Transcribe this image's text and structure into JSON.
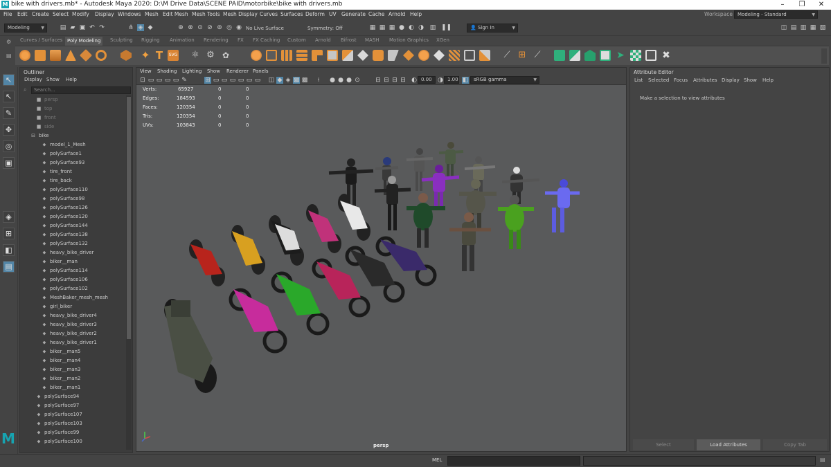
{
  "window": {
    "title": "bike with drivers.mb* - Autodesk Maya 2020: D:\\M Drive Data\\SCENE PAID\\motorbike\\bike with drivers.mb"
  },
  "menubar": {
    "items": [
      "File",
      "Edit",
      "Create",
      "Select",
      "Modify",
      "Display",
      "Windows",
      "Mesh",
      "Edit Mesh",
      "Mesh Tools",
      "Mesh Display",
      "Curves",
      "Surfaces",
      "Deform",
      "UV",
      "Generate",
      "Cache",
      "Arnold",
      "Help"
    ],
    "workspace_label": "Workspace :",
    "workspace_value": "Modeling - Standard"
  },
  "statusline": {
    "mode": "Modeling",
    "live_surface": "No Live Surface",
    "symmetry": "Symmetry: Off",
    "sign_in": "Sign In"
  },
  "shelf": {
    "tabs": [
      "Curves / Surfaces",
      "Poly Modeling",
      "Sculpting",
      "Rigging",
      "Animation",
      "Rendering",
      "FX",
      "FX Caching",
      "Custom",
      "Arnold",
      "Bifrost",
      "MASH",
      "Motion Graphics",
      "XGen"
    ],
    "active_tab": "Poly Modeling"
  },
  "outliner": {
    "title": "Outliner",
    "menu": [
      "Display",
      "Show",
      "Help"
    ],
    "search_placeholder": "Search...",
    "cameras": [
      "persp",
      "top",
      "front",
      "side"
    ],
    "group": "bike",
    "children": [
      "model_1_Mesh",
      "polySurface1",
      "polySurface93",
      "tire_front",
      "tire_back",
      "polySurface110",
      "polySurface98",
      "polySurface126",
      "polySurface120",
      "polySurface144",
      "polySurface138",
      "polySurface132",
      "heavy_bike_driver",
      "biker__man",
      "polySurface114",
      "polySurface106",
      "polySurface102",
      "MeshBaker_mesh_mesh",
      "girl_biker",
      "heavy_bike_driver4",
      "heavy_bike_driver3",
      "heavy_bike_driver2",
      "heavy_bike_driver1",
      "biker__man5",
      "biker__man4",
      "biker__man3",
      "biker__man2",
      "biker__man1"
    ],
    "roots": [
      "polySurface94",
      "polySurface97",
      "polySurface107",
      "polySurface103",
      "polySurface99",
      "polySurface100"
    ]
  },
  "viewport": {
    "menu": [
      "View",
      "Shading",
      "Lighting",
      "Show",
      "Renderer",
      "Panels"
    ],
    "exposure": "0.00",
    "gamma": "1.00",
    "colorspace": "sRGB gamma",
    "hud": [
      {
        "label": "Verts:",
        "a": "65927",
        "b": "0",
        "c": "0"
      },
      {
        "label": "Edges:",
        "a": "184593",
        "b": "0",
        "c": "0"
      },
      {
        "label": "Faces:",
        "a": "120354",
        "b": "0",
        "c": "0"
      },
      {
        "label": "Tris:",
        "a": "120354",
        "b": "0",
        "c": "0"
      },
      {
        "label": "UVs:",
        "a": "103843",
        "b": "0",
        "c": "0"
      }
    ],
    "camera": "persp"
  },
  "attribute_editor": {
    "title": "Attribute Editor",
    "menu": [
      "List",
      "Selected",
      "Focus",
      "Attributes",
      "Display",
      "Show",
      "Help"
    ],
    "message": "Make a selection to view attributes",
    "buttons": [
      "Select",
      "Load Attributes",
      "Copy Tab"
    ]
  },
  "command": {
    "label": "MEL"
  },
  "colors": {
    "bg": "#444444",
    "viewport": "#595a5b",
    "accent": "#5285a6"
  }
}
